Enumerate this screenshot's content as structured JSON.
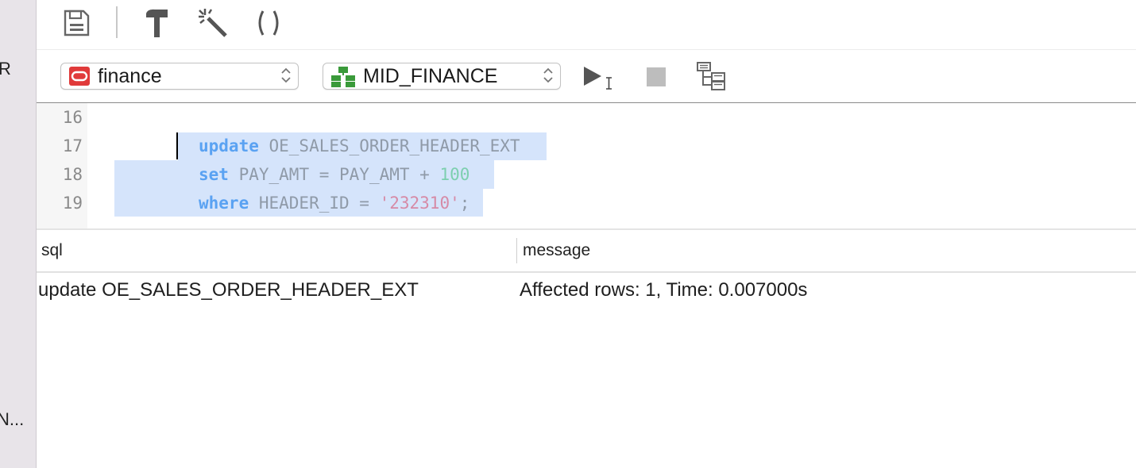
{
  "sidebar": {
    "fragment_top": "R",
    "fragment_bottom": "N..."
  },
  "toolbar": {
    "buttons": [
      {
        "icon": "save-icon"
      },
      {
        "icon": "hammer-icon"
      },
      {
        "icon": "magic-wand-icon"
      },
      {
        "icon": "parentheses-icon"
      }
    ]
  },
  "connection": {
    "value": "finance",
    "icon": "oracle-icon",
    "color": "#e03a3a"
  },
  "schema": {
    "value": "MID_FINANCE",
    "icon": "schema-icon",
    "color": "#3a9a3a"
  },
  "editor": {
    "line_numbers": [
      "16",
      "17",
      "18",
      "19"
    ],
    "lines": [
      {
        "keyword": "",
        "rest": ""
      },
      {
        "keyword": "update",
        "rest": " OE_SALES_ORDER_HEADER_EXT"
      },
      {
        "keyword": "set",
        "rest": " PAY_AMT = PAY_AMT + ",
        "number": "100"
      },
      {
        "keyword": "where",
        "rest": " HEADER_ID = ",
        "string": "'232310'",
        "tail": ";"
      }
    ]
  },
  "results": {
    "columns": [
      "sql",
      "message"
    ],
    "rows": [
      {
        "sql": "update OE_SALES_ORDER_HEADER_EXT",
        "message": "Affected rows: 1, Time: 0.007000s"
      }
    ]
  }
}
